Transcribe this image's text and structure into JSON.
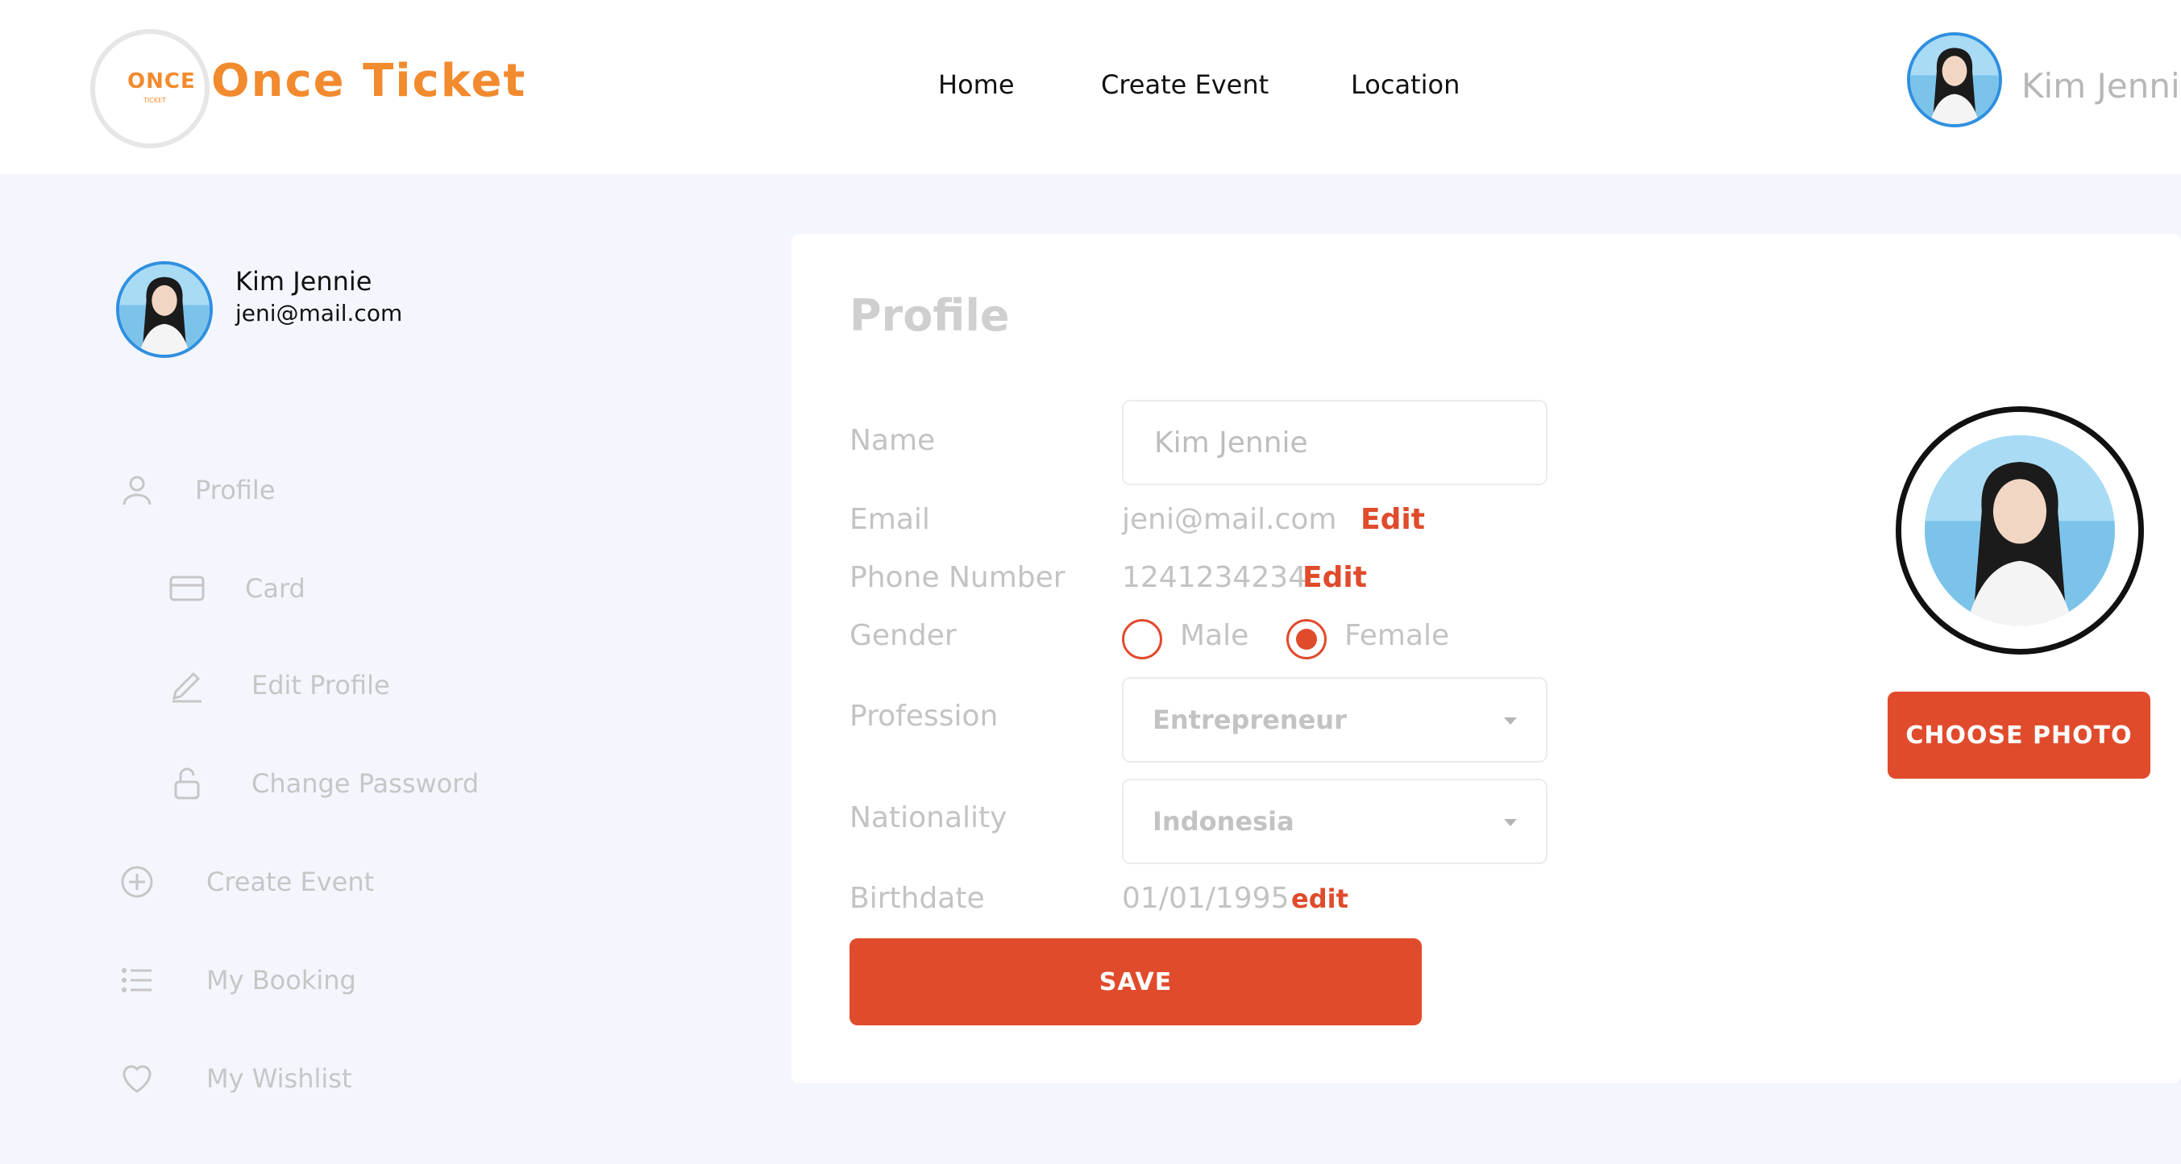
{
  "header": {
    "logo_text": "ONCE",
    "logo_subtext": "TICKET",
    "brand": "Once Ticket",
    "nav": [
      "Home",
      "Create Event",
      "Location"
    ],
    "user_name": "Kim Jennie"
  },
  "sidebar": {
    "user_name": "Kim Jennie",
    "user_email": "jeni@mail.com",
    "items": [
      {
        "label": "Profile",
        "icon": "user-icon"
      },
      {
        "label": "Card",
        "icon": "card-icon"
      },
      {
        "label": "Edit Profile",
        "icon": "pencil-icon"
      },
      {
        "label": "Change Password",
        "icon": "unlock-icon"
      },
      {
        "label": "Create Event",
        "icon": "plus-circle-icon"
      },
      {
        "label": "My Booking",
        "icon": "list-icon"
      },
      {
        "label": "My Wishlist",
        "icon": "heart-icon"
      }
    ]
  },
  "profile": {
    "title": "Profile",
    "labels": {
      "name": "Name",
      "email": "Email",
      "phone": "Phone Number",
      "gender": "Gender",
      "profession": "Profession",
      "nationality": "Nationality",
      "birthdate": "Birthdate"
    },
    "name_value": "Kim Jennie",
    "email_value": "jeni@mail.com",
    "email_edit": "Edit",
    "phone_value": "1241234234",
    "phone_edit": "Edit",
    "gender_options": [
      "Male",
      "Female"
    ],
    "gender_selected": "Female",
    "profession_value": "Entrepreneur",
    "nationality_value": "Indonesia",
    "birthdate_value": "01/01/1995",
    "birthdate_edit": "edit",
    "save_label": "SAVE",
    "choose_photo_label": "CHOOSE PHOTO"
  },
  "colors": {
    "brand": "#f28a2e",
    "accent": "#e04b2c",
    "avatar_ring": "#2f8fe0",
    "page_bg": "#f3f6fd"
  }
}
